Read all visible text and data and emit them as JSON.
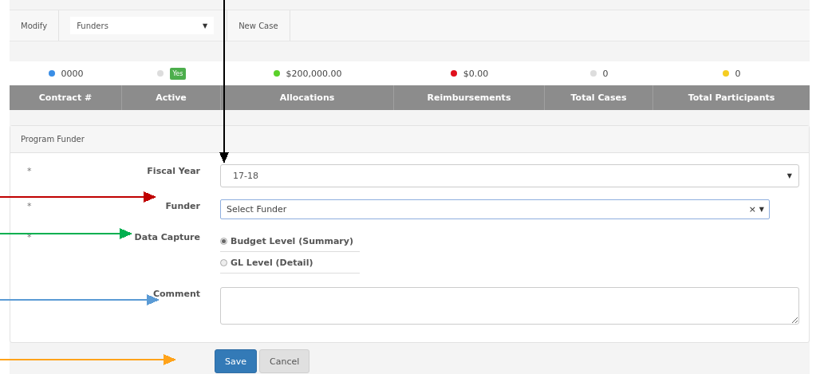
{
  "toolbar": {
    "items": [
      {
        "kind": "button",
        "label": "Modify"
      },
      {
        "kind": "select",
        "label": "Funders",
        "caret": "▼"
      },
      {
        "kind": "button",
        "label": "New Case"
      }
    ]
  },
  "summary": {
    "columns": [
      {
        "header": "Contract #",
        "kind": "text",
        "value": "0000",
        "color": "#3a8ee6"
      },
      {
        "header": "Active",
        "kind": "badge",
        "value": "Yes",
        "color": "#dddddd"
      },
      {
        "header": "Allocations",
        "kind": "text",
        "value": "$200,000.00",
        "color": "#5ad12a"
      },
      {
        "header": "Reimbursements",
        "kind": "text",
        "value": "$0.00",
        "color": "#e0101c"
      },
      {
        "header": "Total Cases",
        "kind": "text",
        "value": "0",
        "color": "#dddddd"
      },
      {
        "header": "Total Participants",
        "kind": "text",
        "value": "0",
        "color": "#f5cd22"
      }
    ]
  },
  "panel": {
    "title": "Program Funder",
    "fields": [
      {
        "kind": "select",
        "marker": "*",
        "label": "Fiscal Year",
        "value": "17-18",
        "caret": "▼"
      },
      {
        "kind": "combo",
        "marker": "*",
        "label": "Funder",
        "placeholder": "Select Funder",
        "clear": "×",
        "caret": "▼"
      },
      {
        "kind": "radio",
        "marker": "*",
        "label": "Data Capture",
        "options": [
          {
            "label": "Budget Level (Summary)",
            "selected": true
          },
          {
            "label": "GL Level (Detail)",
            "selected": false
          }
        ]
      },
      {
        "kind": "textarea",
        "label": "Comment"
      }
    ]
  },
  "buttons": [
    {
      "kind": "primary",
      "label": "Save"
    },
    {
      "kind": "secondary",
      "label": "Cancel"
    }
  ],
  "arrows": [
    {
      "color": "#000000"
    },
    {
      "color": "#c00000"
    },
    {
      "color": "#00b050"
    },
    {
      "color": "#5b9bd5"
    },
    {
      "color": "#ffa31a"
    }
  ]
}
